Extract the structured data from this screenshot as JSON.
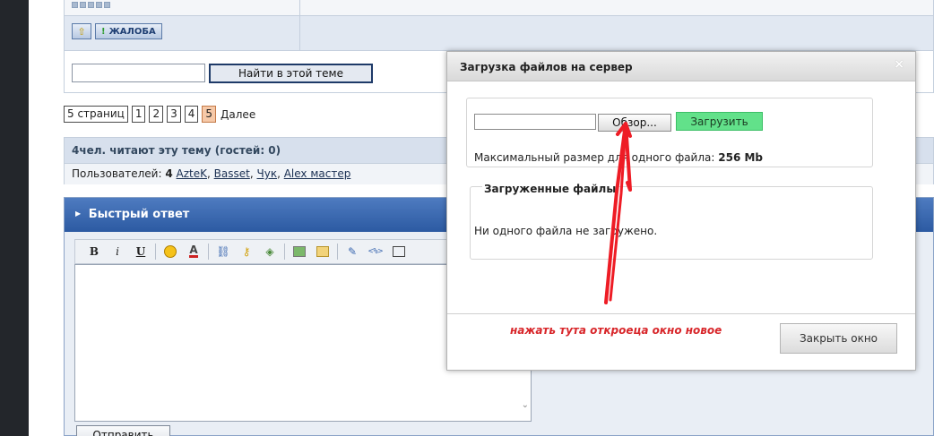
{
  "post": {
    "up_icon": "arrow-up-icon",
    "complain_label": "ЖАЛОБА"
  },
  "search": {
    "placeholder": "",
    "button_label": "Найти в этой теме"
  },
  "pagination": {
    "pages_label": "5 страниц",
    "pages": [
      "1",
      "2",
      "3",
      "4",
      "5"
    ],
    "current": "5",
    "next_label": "Далее"
  },
  "readers": {
    "header": "4чел. читают эту тему (гостей: 0)",
    "users_prefix": "Пользователей:",
    "users_count": "4",
    "users": [
      "AzteK",
      "Basset",
      "Чук",
      "Alex мастер"
    ]
  },
  "quick_reply": {
    "title": "Быстрый ответ",
    "toolbar": {
      "bold": "B",
      "italic": "i",
      "underline": "U",
      "font_color": "A"
    },
    "submit_label": "Отправить"
  },
  "modal": {
    "title": "Загрузка файлов на сервер",
    "close_glyph": "×",
    "browse_label": "Обзор...",
    "upload_label": "Загрузить",
    "max_size_prefix": "Максимальный размер для одного файла:",
    "max_size_value": "256 Mb",
    "uploaded_title": "Загруженные файлы",
    "uploaded_empty": "Ни одного файла не загружено.",
    "close_window_label": "Закрыть окно",
    "annotation": "нажать тута   откроеца окно новое"
  },
  "colors": {
    "accent_blue": "#2c5aa2",
    "upload_green": "#62e18a",
    "annotation_red": "#d8262a",
    "current_page": "#f6c9a8"
  }
}
